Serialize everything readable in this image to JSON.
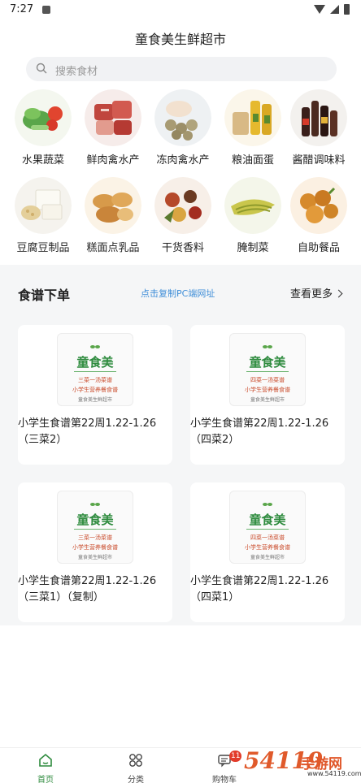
{
  "status_bar": {
    "time": "7:27"
  },
  "header": {
    "title": "童食美生鲜超市"
  },
  "search": {
    "placeholder": "搜索食材"
  },
  "categories": [
    {
      "label": "水果蔬菜",
      "icon": "fruit-vegetable-image"
    },
    {
      "label": "鲜肉禽水产",
      "icon": "fresh-meat-image"
    },
    {
      "label": "冻肉禽水产",
      "icon": "frozen-meat-image"
    },
    {
      "label": "粮油面蛋",
      "icon": "grain-oil-image"
    },
    {
      "label": "酱醋调味料",
      "icon": "sauce-image"
    },
    {
      "label": "豆腐豆制品",
      "icon": "tofu-image"
    },
    {
      "label": "糕面点乳品",
      "icon": "bread-image"
    },
    {
      "label": "干货香料",
      "icon": "spice-image"
    },
    {
      "label": "腌制菜",
      "icon": "pickle-image"
    },
    {
      "label": "自助餐品",
      "icon": "buffet-image"
    }
  ],
  "recipes_section": {
    "title": "食谱下单",
    "copy_link": "点击复制PC端网址",
    "more": "查看更多"
  },
  "recipe_cards": [
    {
      "title": "小学生食谱第22周1.22-1.26（三菜2）",
      "thumb": {
        "logo": "童食美",
        "line1": "三菜一汤菜谱",
        "line2": "小学生营养餐食谱",
        "line3": "童食美生鲜超市"
      }
    },
    {
      "title": "小学生食谱第22周1.22-1.26（四菜2）",
      "thumb": {
        "logo": "童食美",
        "line1": "四菜一汤菜谱",
        "line2": "小学生营养餐食谱",
        "line3": "童食美生鲜超市"
      }
    },
    {
      "title": "小学生食谱第22周1.22-1.26（三菜1）（复制）",
      "thumb": {
        "logo": "童食美",
        "line1": "三菜一汤菜谱",
        "line2": "小学生营养餐食谱",
        "line3": "童食美生鲜超市"
      }
    },
    {
      "title": "小学生食谱第22周1.22-1.26（四菜1）",
      "thumb": {
        "logo": "童食美",
        "line1": "四菜一汤菜谱",
        "line2": "小学生营养餐食谱",
        "line3": "童食美生鲜超市"
      }
    }
  ],
  "tabbar": {
    "home": "首页",
    "category": "分类",
    "cart": "购物车",
    "cart_badge": "11"
  },
  "watermark": {
    "number": "54119",
    "text": "手游网",
    "url": "www.54119.com"
  },
  "colors": {
    "accent": "#2e8b3e",
    "link": "#3f8ed8",
    "badge": "#e23b2a"
  }
}
